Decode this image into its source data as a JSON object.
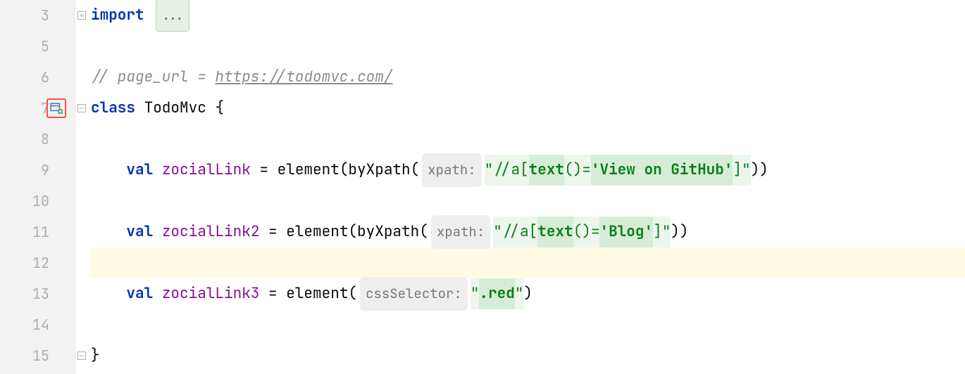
{
  "lines": {
    "l3": "3",
    "l5": "5",
    "l6": "6",
    "l7": "7",
    "l8": "8",
    "l9": "9",
    "l10": "10",
    "l11": "11",
    "l12": "12",
    "l13": "13",
    "l14": "14",
    "l15": "15"
  },
  "code": {
    "import_kw": "import",
    "fold_dots": "...",
    "comment_prefix": "// page_url = ",
    "comment_url": "https://todomvc.com/",
    "class_kw": "class",
    "class_name": " TodoMvc {",
    "val_kw": "val",
    "field1": " zocialLink",
    "assign1": " = element(byXpath(",
    "hint_xpath": "xpath:",
    "str1_q1": "\"",
    "str1_p1": "//a[",
    "str1_bold1": "text",
    "str1_p2": "()=",
    "str1_bold2": "'View on GitHub'",
    "str1_p3": "]",
    "str1_q2": "\"",
    "close1": "))",
    "field2": " zocialLink2",
    "assign2": " = element(byXpath(",
    "str2_q1": "\"",
    "str2_p1": "//a[",
    "str2_bold1": "text",
    "str2_p2": "()=",
    "str2_bold2": "'Blog'",
    "str2_p3": "]",
    "str2_q2": "\"",
    "close2": "))",
    "field3": " zocialLink3",
    "assign3": " = element(",
    "hint_css": "cssSelector:",
    "str3_q1": "\"",
    "str3_bold": ".red",
    "str3_q2": "\"",
    "close3": ")",
    "brace_close": "}"
  }
}
